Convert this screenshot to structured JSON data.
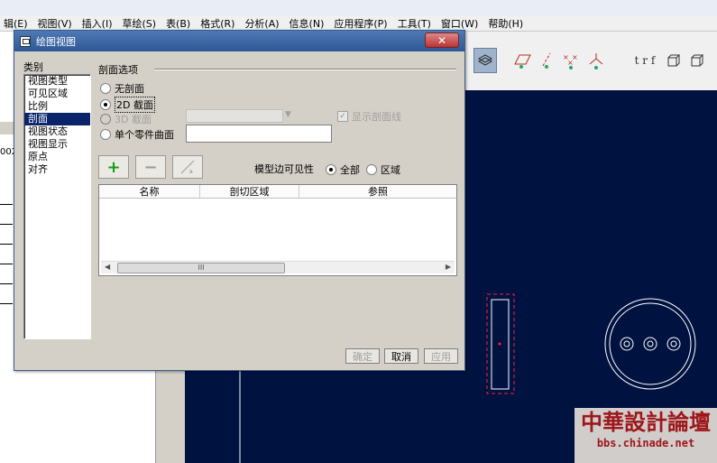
{
  "menu": [
    "辑(E)",
    "视图(V)",
    "插入(I)",
    "草绘(S)",
    "表(B)",
    "格式(R)",
    "分析(A)",
    "信息(N)",
    "应用程序(P)",
    "工具(T)",
    "窗口(W)",
    "帮助(H)"
  ],
  "toolbar_text": "t r f",
  "left_code": "002",
  "dialog": {
    "title": "绘图视图",
    "close_symbol": "✕",
    "category_label": "类别",
    "categories": [
      "视图类型",
      "可见区域",
      "比例",
      "剖面",
      "视图状态",
      "视图显示",
      "原点",
      "对齐"
    ],
    "selected_category": "剖面",
    "section_options_label": "剖面选项",
    "radio_none": "无剖面",
    "radio_2d": "2D 截面",
    "radio_3d": "3D 截面",
    "radio_part": "单个零件曲面",
    "show_section_line": "显示剖面线",
    "model_edge_visibility": "模型边可见性",
    "vis_all": "全部",
    "vis_area": "区域",
    "add_symbol": "+",
    "remove_symbol": "−",
    "table_headers": [
      "名称",
      "剖切区域",
      "参照"
    ],
    "scroll_grip": "III",
    "ok": "确定",
    "cancel": "取消",
    "apply": "应用"
  },
  "watermark": {
    "line1": "中華設計論壇",
    "line2": "bbs.chinade.net"
  }
}
